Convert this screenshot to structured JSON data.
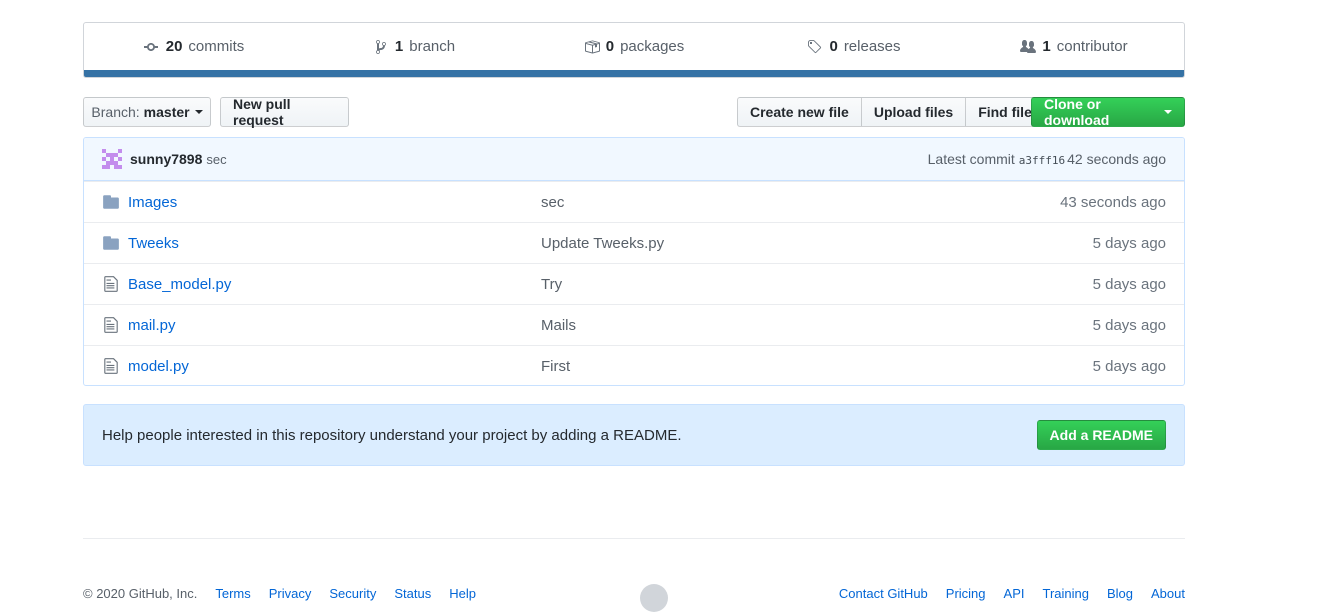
{
  "summary": {
    "commits": {
      "count": "20",
      "label": "commits"
    },
    "branches": {
      "count": "1",
      "label": "branch"
    },
    "packages": {
      "count": "0",
      "label": "packages"
    },
    "releases": {
      "count": "0",
      "label": "releases"
    },
    "contributors": {
      "count": "1",
      "label": "contributor"
    },
    "language_color": "#3572a5"
  },
  "toolbar": {
    "branch_prefix": "Branch:",
    "branch_name": "master",
    "new_pr": "New pull request",
    "create_file": "Create new file",
    "upload_files": "Upload files",
    "find_file": "Find file",
    "clone": "Clone or download"
  },
  "commit": {
    "author": "sunny7898",
    "message": "sec",
    "latest_label": "Latest commit",
    "sha": "a3fff16",
    "age": "42 seconds ago"
  },
  "files": [
    {
      "name": "Images",
      "type": "folder",
      "message": "sec",
      "age": "43 seconds ago"
    },
    {
      "name": "Tweeks",
      "type": "folder",
      "message": "Update Tweeks.py",
      "age": "5 days ago"
    },
    {
      "name": "Base_model.py",
      "type": "file",
      "message": "Try",
      "age": "5 days ago"
    },
    {
      "name": "mail.py",
      "type": "file",
      "message": "Mails",
      "age": "5 days ago"
    },
    {
      "name": "model.py",
      "type": "file",
      "message": "First",
      "age": "5 days ago"
    }
  ],
  "readme": {
    "text": "Help people interested in this repository understand your project by adding a README.",
    "button": "Add a README"
  },
  "footer": {
    "copyright": "© 2020 GitHub, Inc.",
    "left_links": [
      "Terms",
      "Privacy",
      "Security",
      "Status",
      "Help"
    ],
    "right_links": [
      "Contact GitHub",
      "Pricing",
      "API",
      "Training",
      "Blog",
      "About"
    ]
  },
  "colors": {
    "accent_blue": "#0366d6",
    "green_button": "#28a745",
    "readme_bg": "#dbedff"
  }
}
